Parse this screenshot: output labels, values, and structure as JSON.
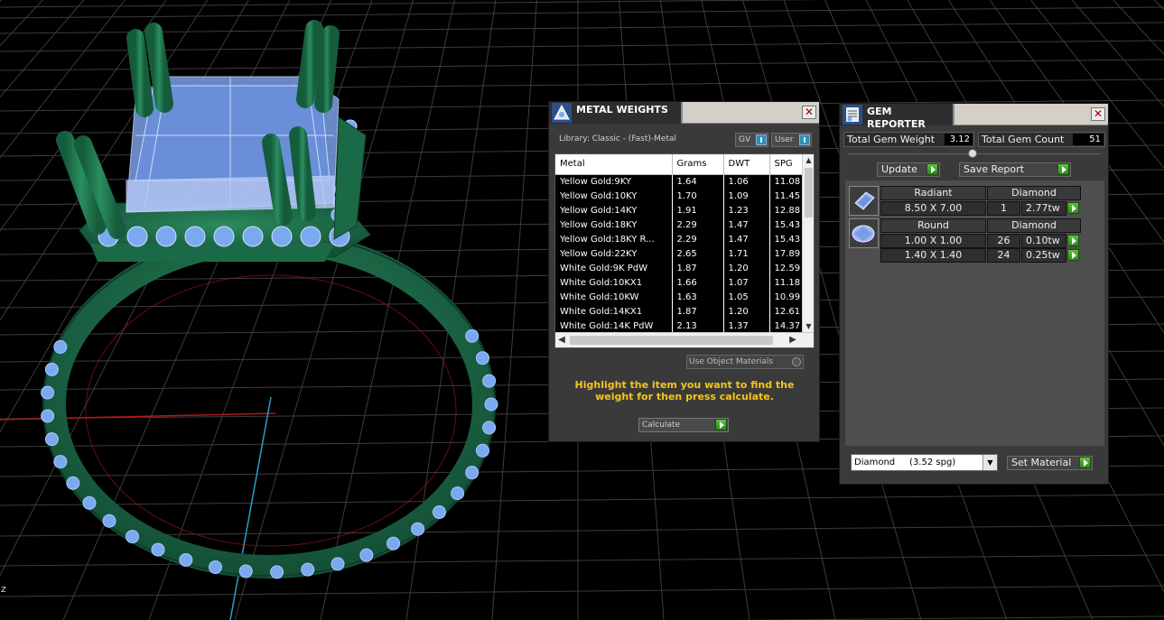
{
  "viewport": {
    "axis_label": "z",
    "colors": {
      "background": "#000000",
      "grid": "#3c3c3c",
      "metal": "#1d6e4a",
      "gem": "#7aa9f0",
      "x_axis": "#b01818",
      "y_axis": "#2aa0c8"
    }
  },
  "metal_weights": {
    "title": "METAL WEIGHTS",
    "library_label": "Library: Classic - (Fast)-Metal",
    "toggle_gv": "GV",
    "toggle_user": "User",
    "columns": [
      "Metal",
      "Grams",
      "DWT",
      "SPG"
    ],
    "rows": [
      [
        "Yellow Gold:9KY",
        "1.64",
        "1.06",
        "11.08"
      ],
      [
        "Yellow Gold:10KY",
        "1.70",
        "1.09",
        "11.45"
      ],
      [
        "Yellow Gold:14KY",
        "1.91",
        "1.23",
        "12.88"
      ],
      [
        "Yellow Gold:18KY",
        "2.29",
        "1.47",
        "15.43"
      ],
      [
        "Yellow Gold:18KY R...",
        "2.29",
        "1.47",
        "15.43"
      ],
      [
        "Yellow Gold:22KY",
        "2.65",
        "1.71",
        "17.89"
      ],
      [
        "White Gold:9K PdW",
        "1.87",
        "1.20",
        "12.59"
      ],
      [
        "White Gold:10KX1",
        "1.66",
        "1.07",
        "11.18"
      ],
      [
        "White Gold:10KW",
        "1.63",
        "1.05",
        "10.99"
      ],
      [
        "White Gold:14KX1",
        "1.87",
        "1.20",
        "12.61"
      ],
      [
        "White Gold:14K PdW",
        "2.13",
        "1.37",
        "14.37"
      ]
    ],
    "use_object_materials": "Use Object Materials",
    "hint": "Highlight the item you want to find the weight for then press calculate.",
    "calculate_label": "Calculate"
  },
  "gem_reporter": {
    "title": "GEM REPORTER",
    "total_gem_weight_label": "Total Gem Weight",
    "total_gem_weight_value": "3.12",
    "total_gem_count_label": "Total Gem Count",
    "total_gem_count_value": "51",
    "update_label": "Update",
    "save_report_label": "Save Report",
    "groups": [
      {
        "shape": "Radiant",
        "material": "Diamond",
        "rows": [
          {
            "size": "8.50 X 7.00",
            "count": "1",
            "weight": "2.77tw"
          }
        ]
      },
      {
        "shape": "Round",
        "material": "Diamond",
        "rows": [
          {
            "size": "1.00 X 1.00",
            "count": "26",
            "weight": "0.10tw"
          },
          {
            "size": "1.40 X 1.40",
            "count": "24",
            "weight": "0.25tw"
          }
        ]
      }
    ],
    "material_select_value": "Diamond     (3.52 spg)",
    "set_material_label": "Set Material"
  }
}
